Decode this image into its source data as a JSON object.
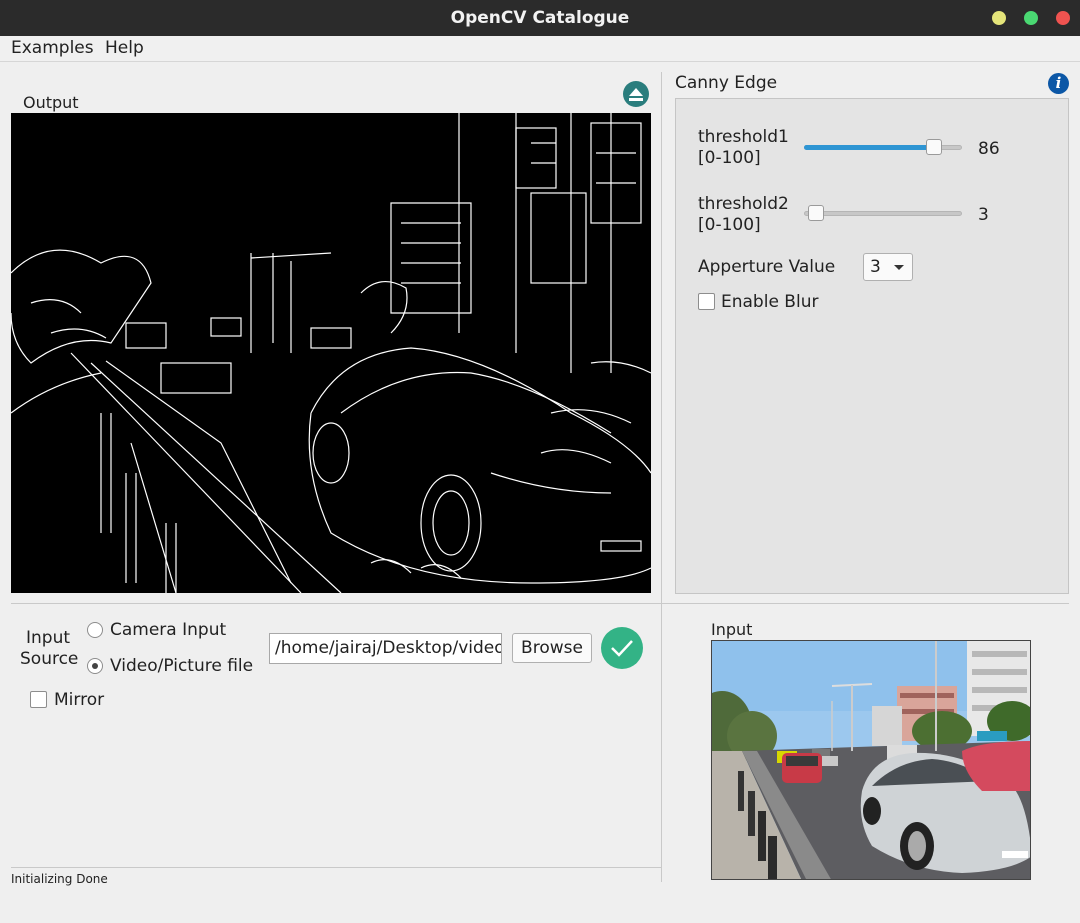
{
  "window": {
    "title": "OpenCV Catalogue"
  },
  "menu": {
    "examples": "Examples",
    "help": "Help"
  },
  "output_panel": {
    "label": "Output"
  },
  "settings": {
    "title": "Canny Edge",
    "threshold1": {
      "label": "threshold1",
      "range": "[0-100]",
      "value": "86",
      "fraction": 0.86
    },
    "threshold2": {
      "label": "threshold2",
      "range": "[0-100]",
      "value": "3",
      "fraction": 0.03
    },
    "aperture": {
      "label": "Apperture Value",
      "value": "3"
    },
    "blur": {
      "label": "Enable Blur",
      "checked": false
    }
  },
  "input_source": {
    "label_line1": "Input",
    "label_line2": "Source",
    "camera_option": "Camera Input",
    "file_option": "Video/Picture file",
    "selected": "file",
    "path": "/home/jairaj/Desktop/video",
    "browse_label": "Browse",
    "mirror_label": "Mirror"
  },
  "input_panel": {
    "label": "Input"
  },
  "status": {
    "text": "Initializing Done"
  },
  "colors": {
    "accent": "#2e95d3",
    "confirm": "#33b386",
    "eject": "#2a7d7d",
    "info": "#0c57a6"
  },
  "icons": [
    "eject-icon",
    "info-icon",
    "check-icon",
    "dropdown-arrow-icon"
  ]
}
